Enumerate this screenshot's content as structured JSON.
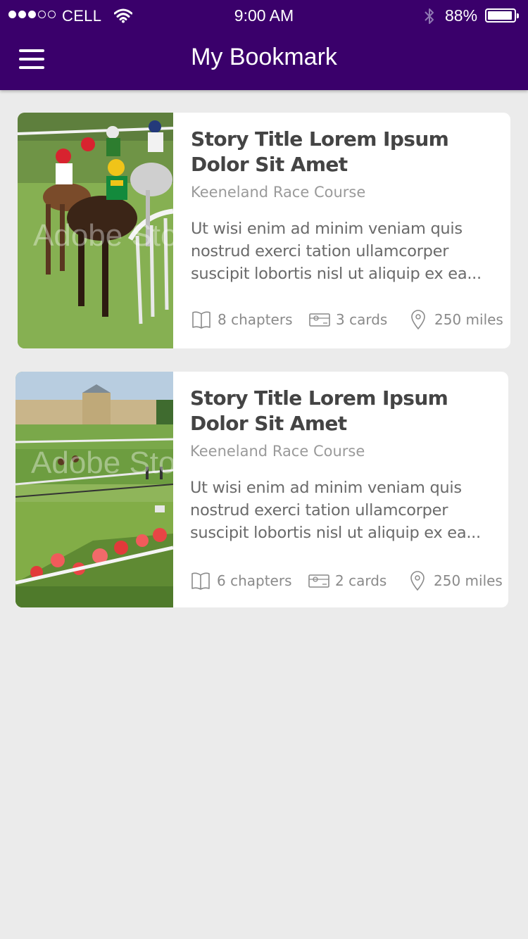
{
  "status_bar": {
    "carrier": "CELL",
    "signal_strength": "3 of 5",
    "time": "9:00 AM",
    "battery_percent": "88%",
    "battery_level": 0.88
  },
  "header": {
    "title": "My Bookmark",
    "menu_icon": "hamburger-menu-icon"
  },
  "colors": {
    "header_background": "#3a006b",
    "page_background": "#ebebeb",
    "card_background": "#ffffff"
  },
  "bookmarks": [
    {
      "title": "Story Title Lorem Ipsum Dolor Sit Amet",
      "location": "Keeneland Race Course",
      "description": "Ut wisi enim ad minim veniam quis nostrud exerci tation ullamcorper suscipit lobortis nisl ut aliquip ex ea...",
      "chapters": "8 chapters",
      "cards": "3 cards",
      "distance": "250 miles",
      "image_watermark": "Adobe Stoc",
      "image": "horse-race-jockeys-photo"
    },
    {
      "title": "Story Title Lorem Ipsum Dolor Sit Amet",
      "location": "Keeneland Race Course",
      "description": "Ut wisi enim ad minim veniam quis nostrud exerci tation ullamcorper suscipit lobortis nisl ut aliquip ex ea...",
      "chapters": "6 chapters",
      "cards": "2 cards",
      "distance": "250 miles",
      "image_watermark": "Adobe Stoc",
      "image": "racecourse-chateau-photo"
    }
  ],
  "icons": {
    "chapters": "book-icon",
    "cards": "card-icon",
    "distance": "location-pin-icon"
  }
}
